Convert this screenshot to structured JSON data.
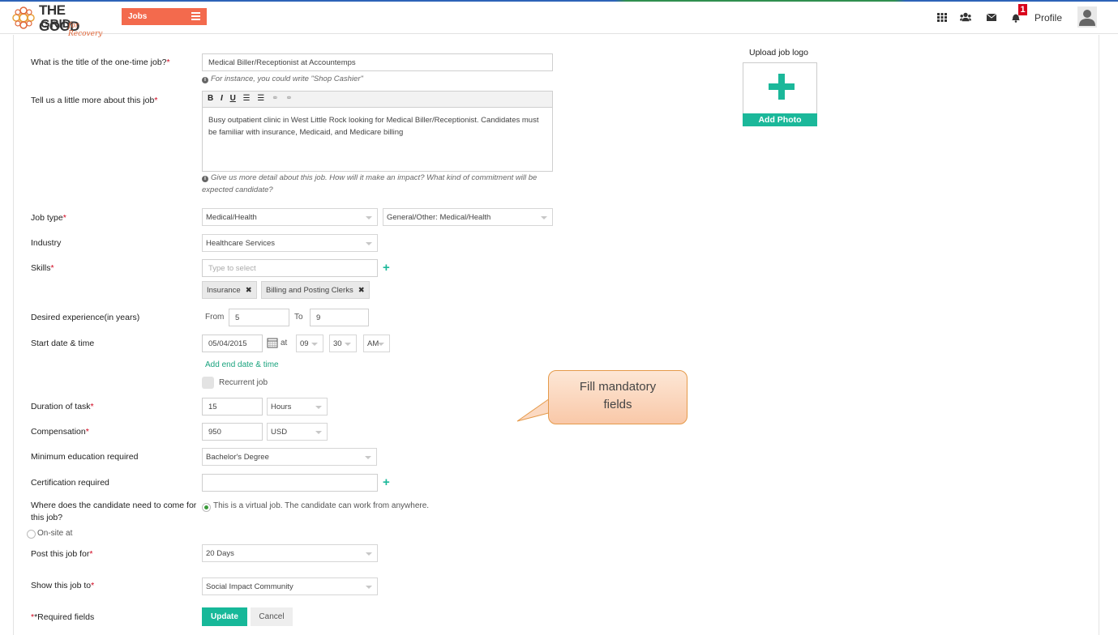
{
  "brand": {
    "logo_good": "THE GOOD",
    "logo_grid": "GRID",
    "logo_for": "for Recovery",
    "accent": "#f36a4d",
    "teal": "#1bb89a"
  },
  "topbar": {
    "jobs_label": "Jobs",
    "notification_count": "1",
    "profile_label": "Profile",
    "icons": [
      "apps-grid-icon",
      "users-icon",
      "mail-icon",
      "bell-icon",
      "avatar-icon"
    ]
  },
  "form": {
    "title_label": "What is the title of the one-time job?",
    "title_value": "Medical Biller/Receptionist at Accountemps",
    "title_hint": "For instance, you could write \"Shop Cashier\"",
    "about_label": "Tell us a little more about this job",
    "about_value": "Busy outpatient clinic in West Little Rock looking for Medical Biller/Receptionist. Candidates must be familiar with insurance, Medicaid, and Medicare billing",
    "about_hint": "Give us more detail about this job. How will it make an impact? What kind of commitment will be expected candidate?",
    "job_type_label": "Job type",
    "job_type_value": "Medical/Health",
    "job_subtype_value": "General/Other: Medical/Health",
    "industry_label": "Industry",
    "industry_value": "Healthcare Services",
    "skills_label": "Skills",
    "skills_placeholder": "Type to select",
    "skills_tags": [
      "Insurance",
      "Billing and Posting Clerks"
    ],
    "experience_label": "Desired experience(in years)",
    "from_label": "From",
    "from_value": "5",
    "to_label": "To",
    "to_value": "9",
    "start_label": "Start date & time",
    "start_date": "05/04/2015",
    "at_label": "at",
    "start_hour": "09",
    "start_min": "30",
    "start_ampm": "AM",
    "add_end_link": "Add end date & time",
    "recurrent_label": "Recurrent job",
    "duration_label": "Duration of task",
    "duration_value": "15",
    "duration_unit": "Hours",
    "compensation_label": "Compensation",
    "compensation_value": "950",
    "compensation_currency": "USD",
    "education_label": "Minimum education required",
    "education_value": "Bachelor's Degree",
    "cert_label": "Certification required",
    "cert_value": "",
    "location_label": "Where does the candidate need to come for this job?",
    "virtual_option": "This is a virtual job. The candidate can work from anywhere.",
    "onsite_option": "On-site at",
    "post_label": "Post this job for",
    "post_value": "20 Days",
    "show_label": "Show this job to",
    "show_value": "Social Impact Community",
    "required_note": "*Required fields",
    "update_label": "Update",
    "cancel_label": "Cancel"
  },
  "upload": {
    "label": "Upload job logo",
    "button": "Add Photo"
  },
  "callout": {
    "text": "Fill mandatory fields"
  }
}
